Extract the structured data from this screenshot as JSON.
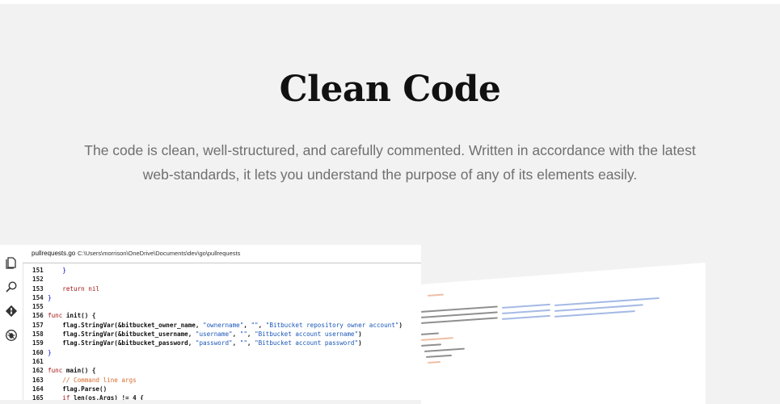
{
  "section": {
    "title": "Clean Code",
    "description": "The code is clean, well-structured, and carefully commented. Written in accordance with the latest web-standards, it lets you understand the purpose of any of its elements easily."
  },
  "editor": {
    "file_name": "pullrequests.go",
    "file_path": "C:\\Users\\morrison\\OneDrive\\Documents\\dev\\go\\pullrequests",
    "activity_icons": [
      "files-icon",
      "search-icon",
      "git-icon",
      "debug-icon"
    ],
    "lines": [
      {
        "n": "151",
        "parts": [
          {
            "t": "    }",
            "c": "kwf"
          }
        ]
      },
      {
        "n": "152",
        "parts": []
      },
      {
        "n": "153",
        "parts": [
          {
            "t": "    return nil",
            "c": "kw"
          }
        ]
      },
      {
        "n": "154",
        "parts": [
          {
            "t": "}",
            "c": "kwf"
          }
        ]
      },
      {
        "n": "155",
        "parts": []
      },
      {
        "n": "156",
        "parts": [
          {
            "t": "func ",
            "c": "kw"
          },
          {
            "t": "init() {",
            "c": "plain"
          }
        ]
      },
      {
        "n": "157",
        "parts": [
          {
            "t": "    flag.StringVar(&bitbucket_owner_name, ",
            "c": "plain"
          },
          {
            "t": "\"ownername\"",
            "c": "str"
          },
          {
            "t": ", ",
            "c": "plain"
          },
          {
            "t": "\"\"",
            "c": "str"
          },
          {
            "t": ", ",
            "c": "plain"
          },
          {
            "t": "\"Bitbucket repository owner account\"",
            "c": "str"
          },
          {
            "t": ")",
            "c": "plain"
          }
        ]
      },
      {
        "n": "158",
        "parts": [
          {
            "t": "    flag.StringVar(&bitbucket_username, ",
            "c": "plain"
          },
          {
            "t": "\"username\"",
            "c": "str"
          },
          {
            "t": ", ",
            "c": "plain"
          },
          {
            "t": "\"\"",
            "c": "str"
          },
          {
            "t": ", ",
            "c": "plain"
          },
          {
            "t": "\"Bitbucket account username\"",
            "c": "str"
          },
          {
            "t": ")",
            "c": "plain"
          }
        ]
      },
      {
        "n": "159",
        "parts": [
          {
            "t": "    flag.StringVar(&bitbucket_password, ",
            "c": "plain"
          },
          {
            "t": "\"password\"",
            "c": "str"
          },
          {
            "t": ", ",
            "c": "plain"
          },
          {
            "t": "\"\"",
            "c": "str"
          },
          {
            "t": ", ",
            "c": "plain"
          },
          {
            "t": "\"Bitbucket account password\"",
            "c": "str"
          },
          {
            "t": ")",
            "c": "plain"
          }
        ]
      },
      {
        "n": "160",
        "parts": [
          {
            "t": "}",
            "c": "kwf"
          }
        ]
      },
      {
        "n": "161",
        "parts": []
      },
      {
        "n": "162",
        "parts": [
          {
            "t": "func ",
            "c": "kw"
          },
          {
            "t": "main() {",
            "c": "plain"
          }
        ]
      },
      {
        "n": "163",
        "parts": [
          {
            "t": "    // Command line args",
            "c": "cm"
          }
        ]
      },
      {
        "n": "164",
        "parts": [
          {
            "t": "    flag.Parse()",
            "c": "plain"
          }
        ]
      },
      {
        "n": "165",
        "parts": [
          {
            "t": "    if ",
            "c": "kw"
          },
          {
            "t": "len(os.Args) != 4 {",
            "c": "plain"
          }
        ]
      }
    ]
  },
  "colors": {
    "section_bg": "#f2f2f2",
    "title": "#111111",
    "description": "#6f6f6f",
    "keyword": "#a31515",
    "string": "#1a57b8",
    "comment": "#d86a2c"
  }
}
